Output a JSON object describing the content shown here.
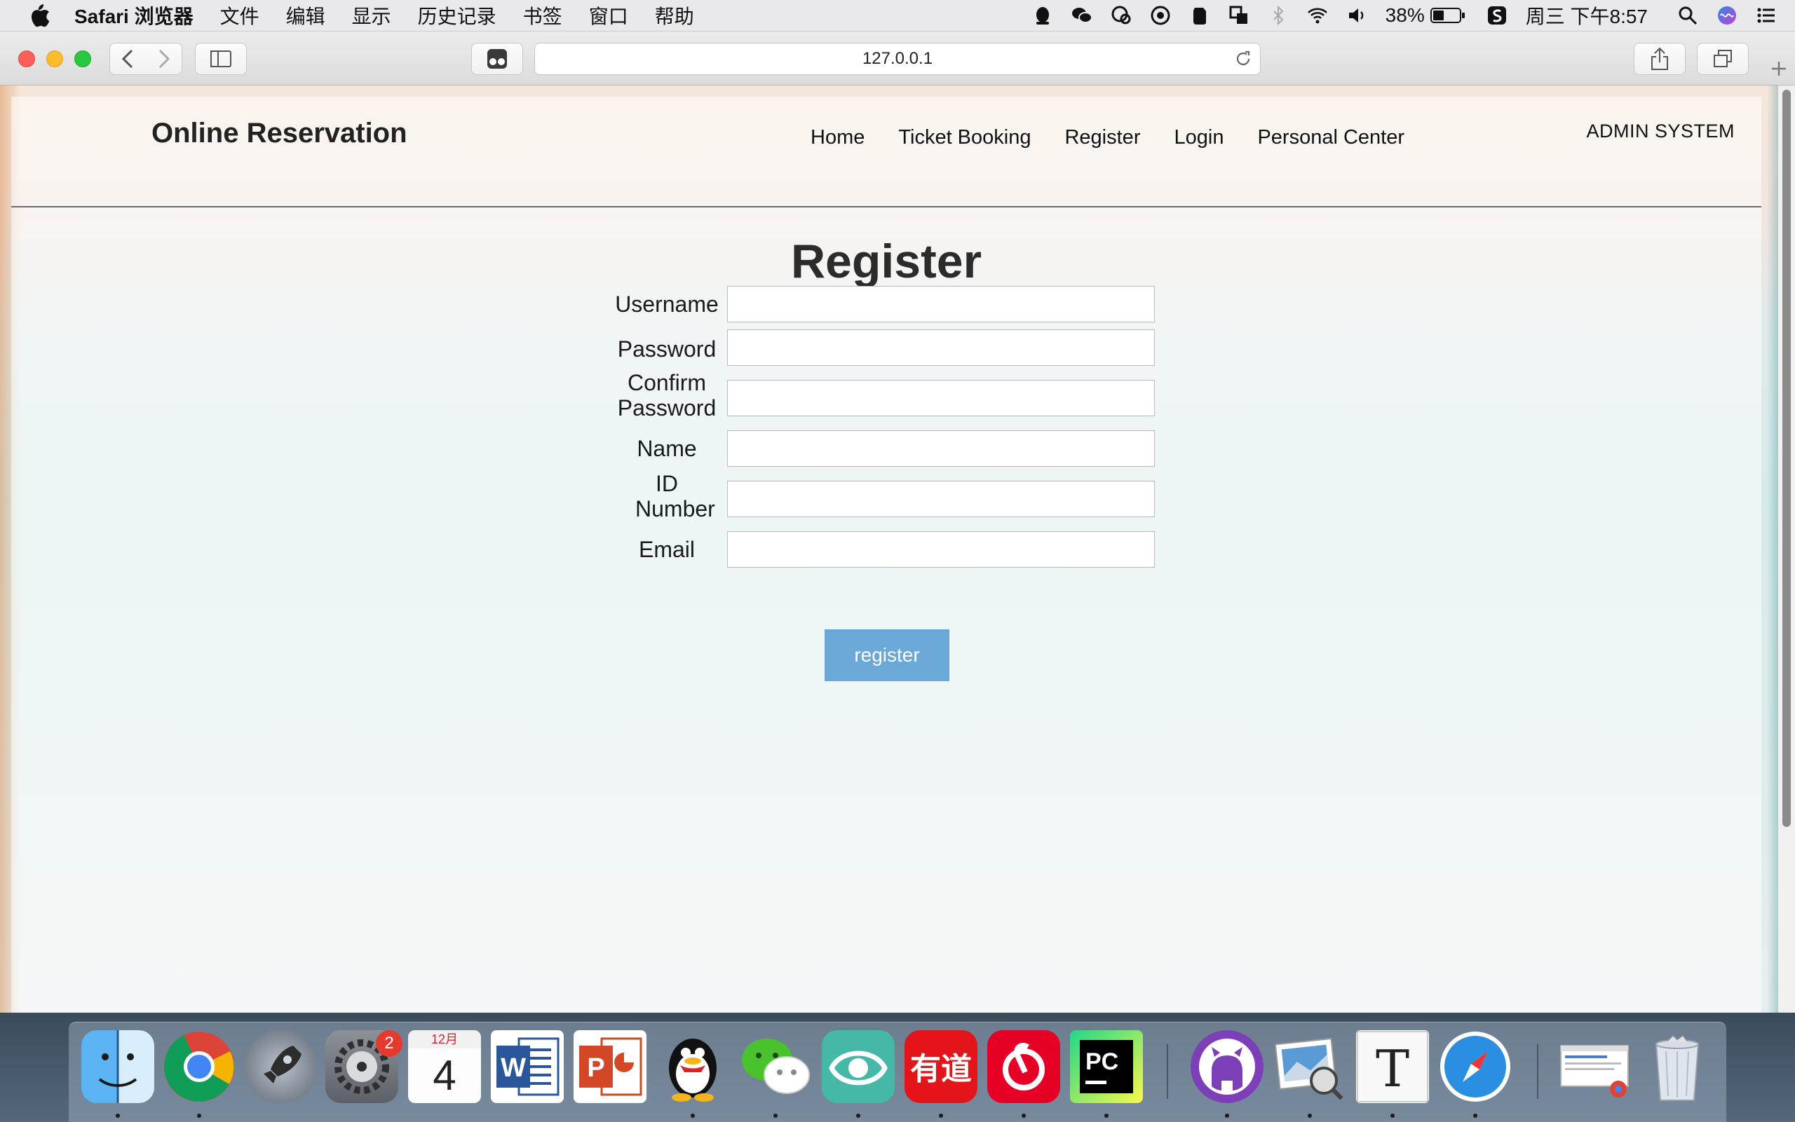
{
  "menubar": {
    "app": "Safari 浏览器",
    "items": [
      "文件",
      "编辑",
      "显示",
      "历史记录",
      "书签",
      "窗口",
      "帮助"
    ],
    "battery": "38%",
    "clock": "周三 下午8:57"
  },
  "browser": {
    "url": "127.0.0.1"
  },
  "site": {
    "title": "Online Reservation",
    "nav": [
      "Home",
      "Ticket Booking",
      "Register",
      "Login",
      "Personal Center"
    ],
    "admin": "ADMIN SYSTEM"
  },
  "form": {
    "title": "Register",
    "fields": [
      {
        "label": "Username",
        "value": ""
      },
      {
        "label": "Password",
        "value": ""
      },
      {
        "label": "Confirm Password",
        "value": ""
      },
      {
        "label": "Name",
        "value": ""
      },
      {
        "label": "ID Number",
        "value": ""
      },
      {
        "label": "Email",
        "value": ""
      }
    ],
    "submit": "register"
  },
  "dock": {
    "calendar_month": "12月",
    "calendar_day": "4",
    "badge": "2",
    "apps": [
      "finder-icon",
      "chrome-icon",
      "launchpad-icon",
      "system-preferences-icon",
      "calendar-icon",
      "word-icon",
      "powerpoint-icon",
      "qq-icon",
      "wechat-icon",
      "eye-app-icon",
      "youdao-icon",
      "netease-music-icon",
      "pycharm-icon",
      "github-desktop-icon",
      "preview-icon",
      "typora-icon",
      "safari-icon",
      "chrome-window-thumbnail",
      "trash-icon"
    ],
    "colors": {
      "word": "#2b579a",
      "powerpoint": "#d24726",
      "youdao": "#e3151b",
      "netease": "#e60026",
      "register_button": "#6aa8d8"
    }
  }
}
